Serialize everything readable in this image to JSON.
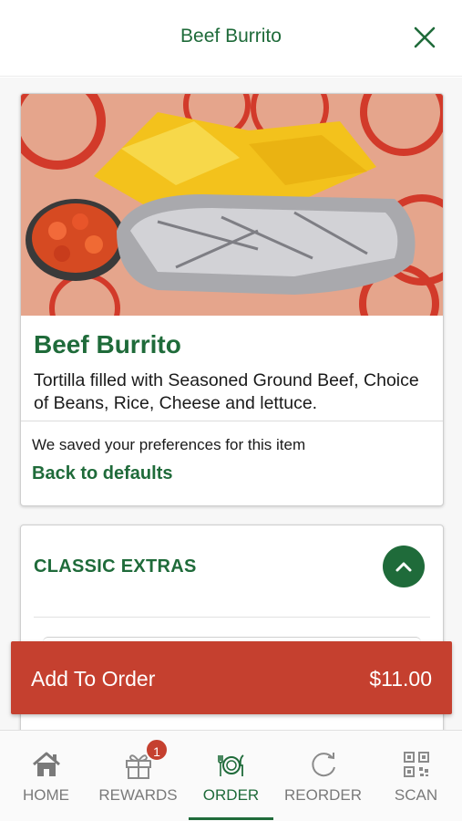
{
  "header": {
    "title": "Beef Burrito",
    "close_icon": "close-icon"
  },
  "item": {
    "name": "Beef Burrito",
    "description": "Tortilla filled with Seasoned Ground Beef, Choice of Beans, Rice, Cheese and lettuce.",
    "preferences_note": "We saved your preferences for this item",
    "back_to_defaults": "Back to defaults"
  },
  "extras": {
    "title": "CLASSIC EXTRAS",
    "toggle_icon": "chevron-up-icon"
  },
  "order_button": {
    "label": "Add To Order",
    "price": "$11.00"
  },
  "tabs": [
    {
      "label": "HOME",
      "icon": "home-icon"
    },
    {
      "label": "REWARDS",
      "icon": "gift-icon",
      "badge": "1"
    },
    {
      "label": "ORDER",
      "icon": "dinner-plate-icon",
      "active": true
    },
    {
      "label": "REORDER",
      "icon": "refresh-icon"
    },
    {
      "label": "SCAN",
      "icon": "qr-code-icon"
    }
  ],
  "colors": {
    "brand_green": "#1f6b3a",
    "accent_red": "#c5402f",
    "inactive_gray": "#7a7a7a"
  }
}
